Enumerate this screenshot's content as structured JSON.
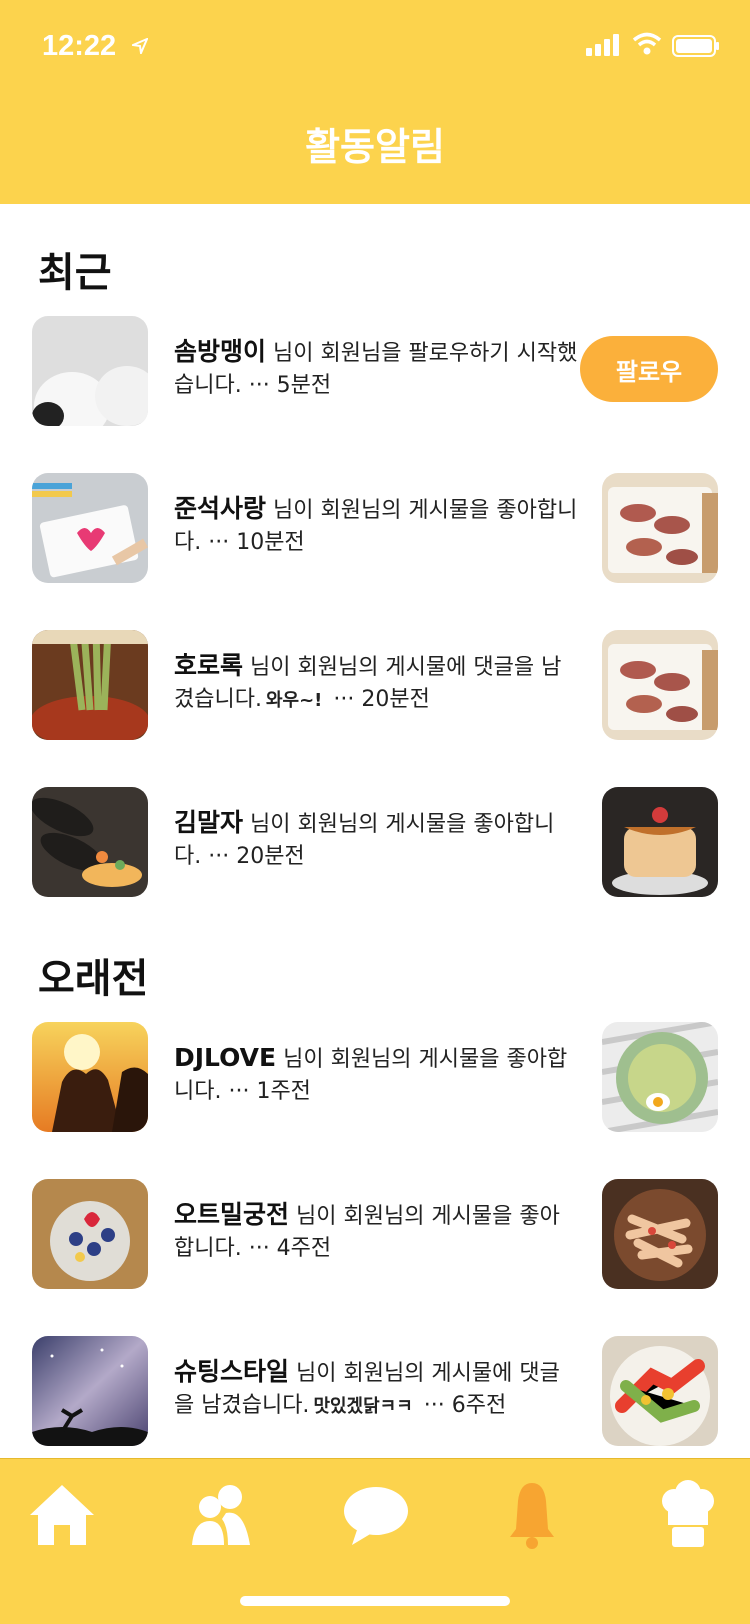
{
  "status_bar": {
    "time": "12:22"
  },
  "header": {
    "title": "활동알림"
  },
  "sections": {
    "recent": "최근",
    "older": "오래전"
  },
  "follow_button_label": "팔로우",
  "notifications": [
    {
      "username": "솜방맹이",
      "message": " 님이 회원님을 팔로우하기 시작했습니다.",
      "comment": "",
      "time": " ··· 5분전"
    },
    {
      "username": "준석사랑",
      "message": " 님이 회원님의 게시물을 좋아합니다.",
      "comment": "",
      "time": " ··· 10분전"
    },
    {
      "username": "호로록",
      "message": " 님이 회원님의 게시물에 댓글을 남겼습니다.",
      "comment": "와우~!",
      "time": " ··· 20분전"
    },
    {
      "username": "김말자",
      "message": " 님이 회원님의 게시물을 좋아합니다.",
      "comment": "",
      "time": " ··· 20분전"
    },
    {
      "username": "DJLOVE",
      "message": " 님이 회원님의 게시물을 좋아합니다.",
      "comment": "",
      "time": " ··· 1주전"
    },
    {
      "username": "오트밀궁전",
      "message": " 님이 회원님의 게시물을 좋아합니다.",
      "comment": "",
      "time": " ··· 4주전"
    },
    {
      "username": "슈팅스타일",
      "message": " 님이 회원님의 게시물에 댓글을 남겼습니다.",
      "comment": "맛있겠닭ㅋㅋ",
      "time": " ··· 6주전"
    }
  ],
  "tabs": [
    "home-icon",
    "friends-icon",
    "chat-icon",
    "bell-icon",
    "chef-icon"
  ],
  "colors": {
    "brand_yellow": "#FCD34D",
    "accent_orange": "#FBB03B",
    "active_tab": "#F7A531"
  }
}
